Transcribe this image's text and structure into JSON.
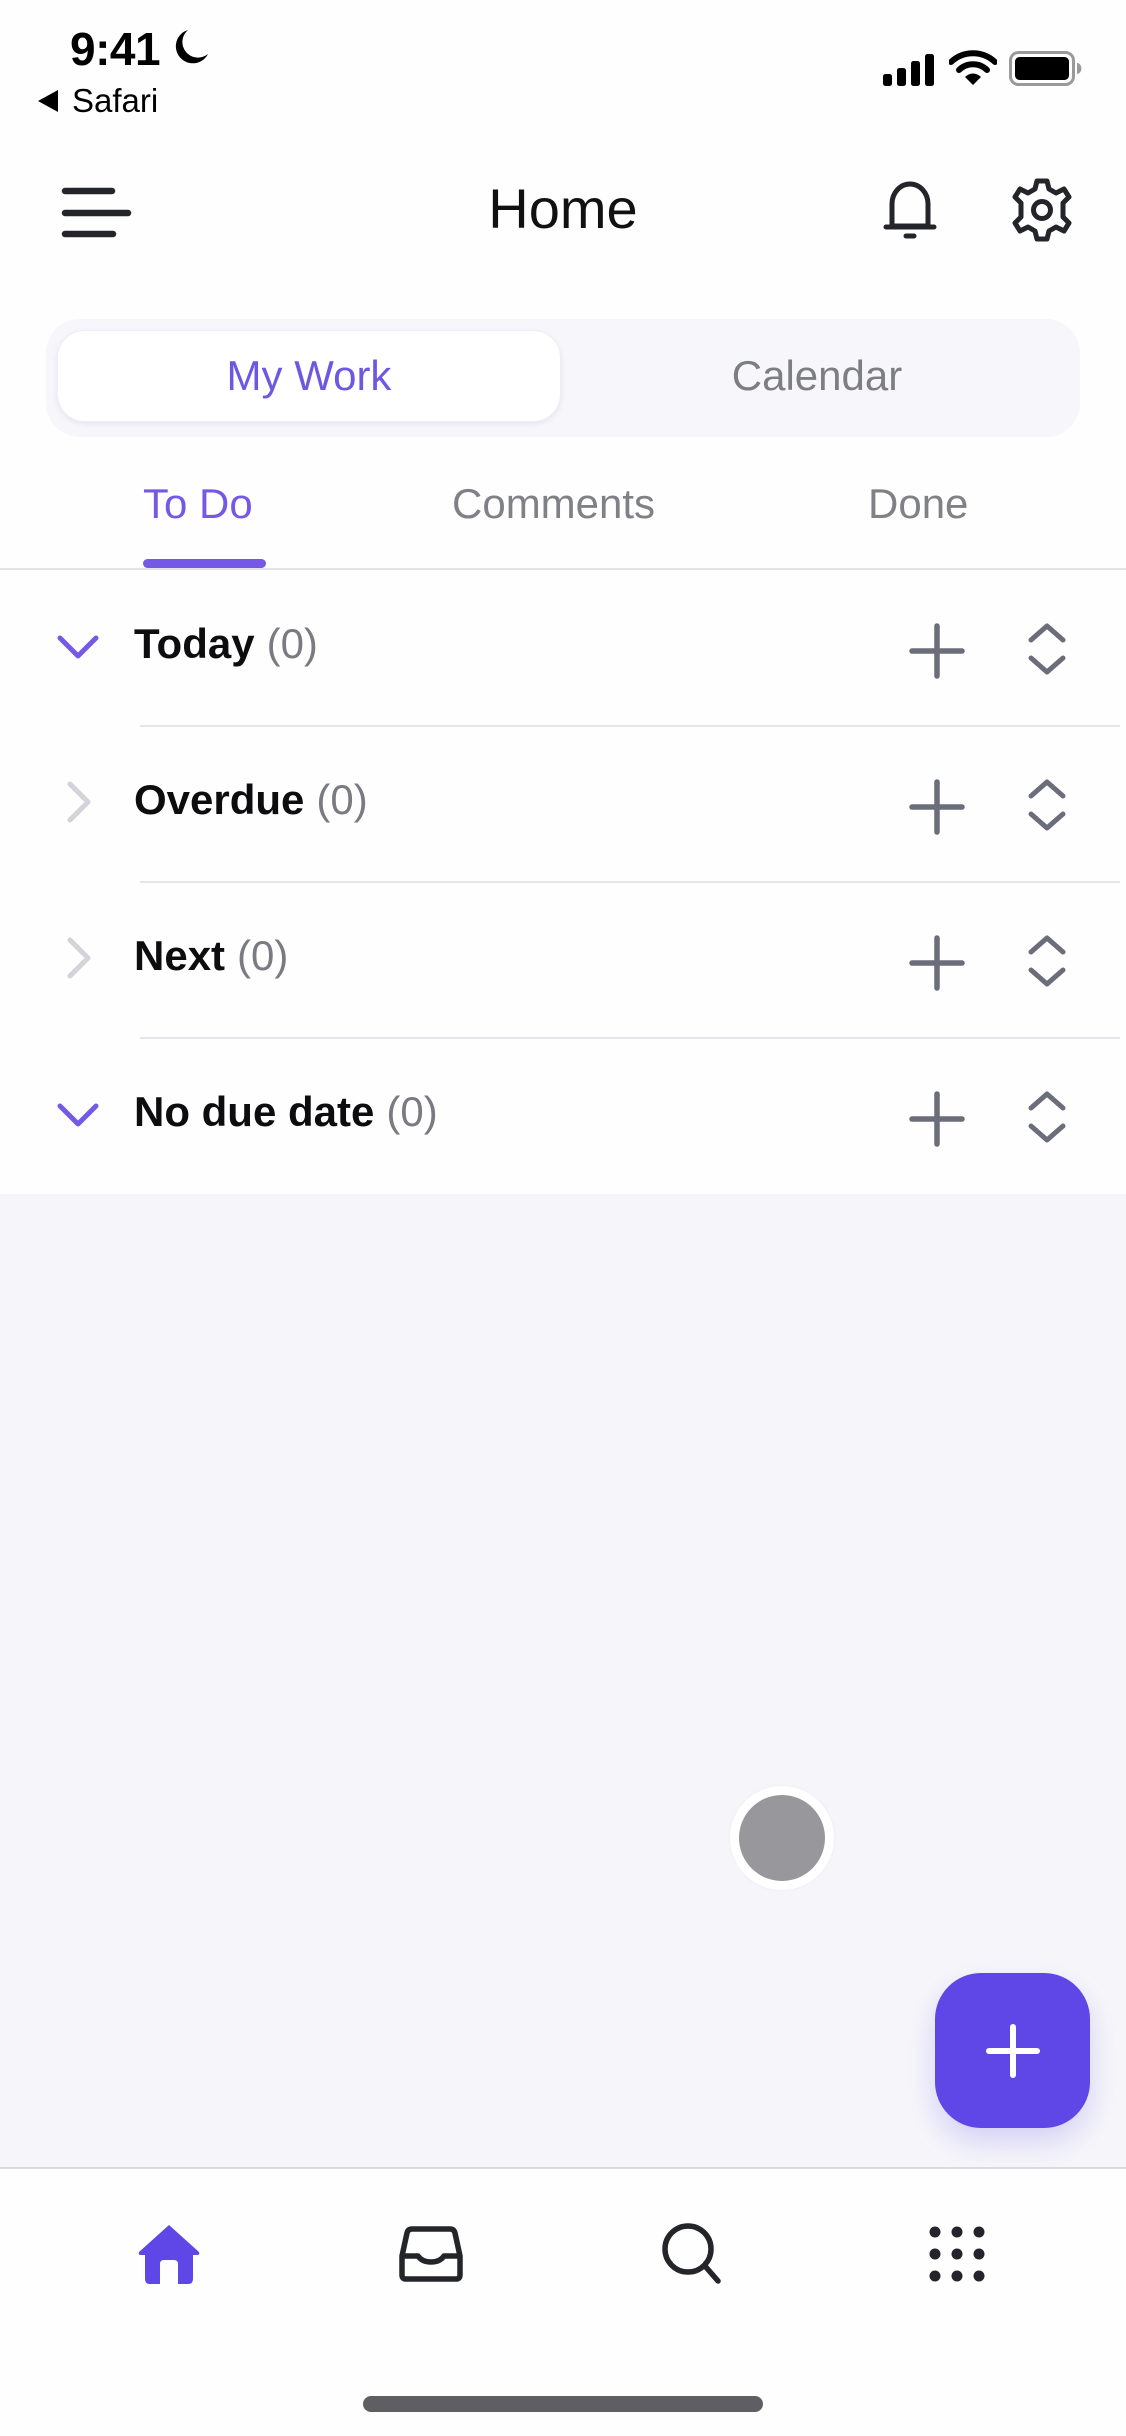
{
  "status_bar": {
    "time": "9:41",
    "back_app": "Safari",
    "icons": [
      "moon-icon",
      "signal-icon",
      "wifi-icon",
      "battery-icon"
    ]
  },
  "header": {
    "title": "Home",
    "left_icon": "menu-icon",
    "right_icons": [
      "bell-icon",
      "gear-icon"
    ]
  },
  "segmented": {
    "options": [
      {
        "label": "My Work",
        "selected": true
      },
      {
        "label": "Calendar",
        "selected": false
      }
    ]
  },
  "tabs": [
    {
      "label": "To Do",
      "active": true
    },
    {
      "label": "Comments",
      "active": false
    },
    {
      "label": "Done",
      "active": false
    }
  ],
  "sections": [
    {
      "title": "Today",
      "count": "(0)",
      "expanded": true
    },
    {
      "title": "Overdue",
      "count": "(0)",
      "expanded": false
    },
    {
      "title": "Next",
      "count": "(0)",
      "expanded": false
    },
    {
      "title": "No due date",
      "count": "(0)",
      "expanded": true
    }
  ],
  "fab": {
    "icon": "plus-icon"
  },
  "tab_bar": {
    "items": [
      {
        "icon": "home-icon",
        "active": true
      },
      {
        "icon": "inbox-icon",
        "active": false
      },
      {
        "icon": "search-icon",
        "active": false
      },
      {
        "icon": "apps-grid-icon",
        "active": false
      }
    ]
  },
  "colors": {
    "accent": "#7559e5",
    "fab": "#5e47e6",
    "background": "#f6f6fa",
    "icon_gray": "#6b6e7a"
  }
}
